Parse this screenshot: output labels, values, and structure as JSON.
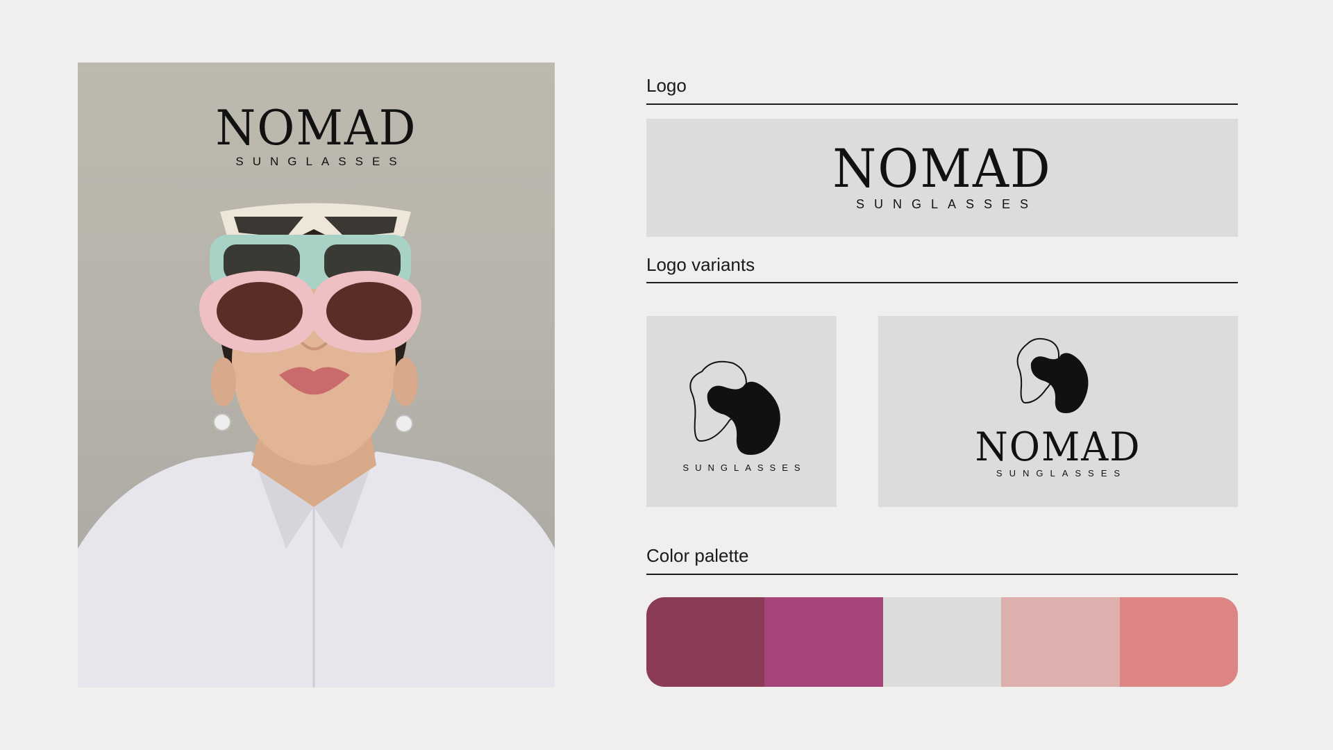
{
  "brand": {
    "name": "NOMAD",
    "tagline": "SUNGLASSES"
  },
  "sections": {
    "logo": "Logo",
    "logo_variants": "Logo variants",
    "color_palette": "Color palette"
  },
  "photo": {
    "subject": "woman-wearing-stacked-sunglasses"
  },
  "palette": [
    "#8b3b55",
    "#a6457b",
    "#dcdcdb",
    "#ddb0ae",
    "#dd8485"
  ],
  "icons": [
    "blob-mark-icon"
  ]
}
